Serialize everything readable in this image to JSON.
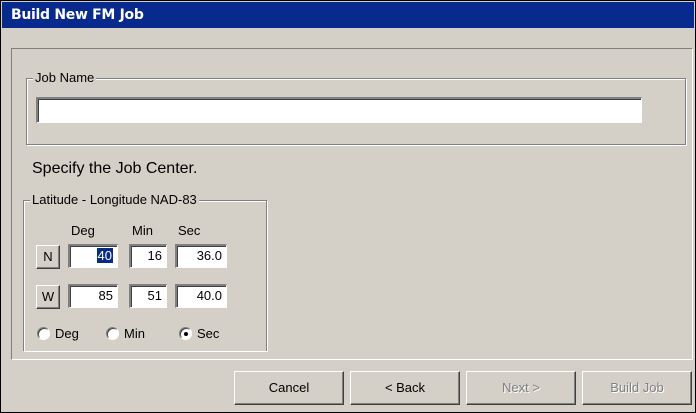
{
  "window": {
    "title": "Build New FM Job"
  },
  "job_name": {
    "label": "Job Name",
    "value": ""
  },
  "instruction": "Specify the Job Center.",
  "coords": {
    "group_label": "Latitude - Longitude NAD-83",
    "headers": {
      "deg": "Deg",
      "min": "Min",
      "sec": "Sec"
    },
    "lat": {
      "dir": "N",
      "deg": "40",
      "min": "16",
      "sec": "36.0"
    },
    "lon": {
      "dir": "W",
      "deg": "85",
      "min": "51",
      "sec": "40.0"
    },
    "format_options": {
      "deg": "Deg",
      "min": "Min",
      "sec": "Sec"
    },
    "selected_format": "Sec"
  },
  "buttons": {
    "cancel": "Cancel",
    "back": "< Back",
    "next": "Next >",
    "build": "Build Job"
  }
}
